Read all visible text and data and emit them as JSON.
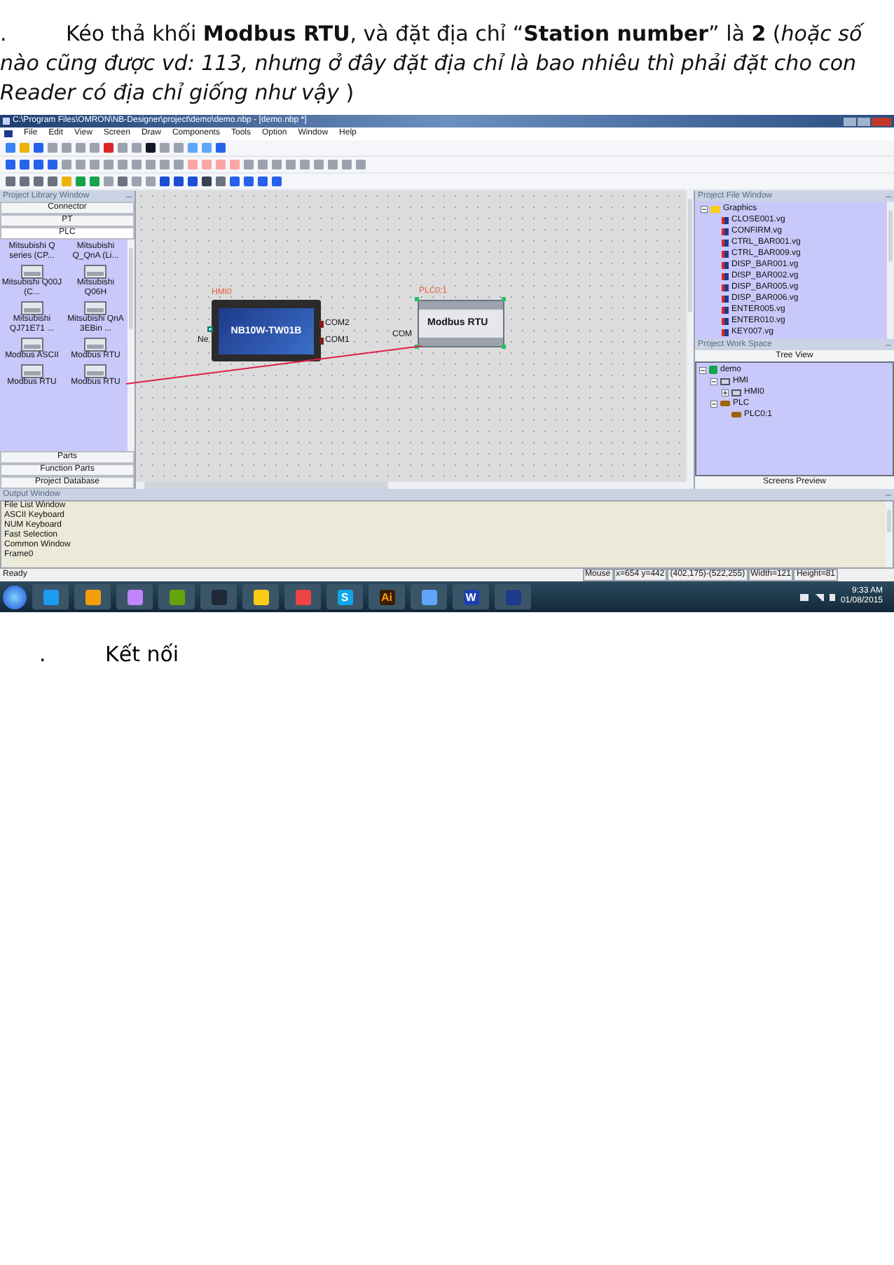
{
  "intro": {
    "bullet": ".",
    "text": "Kéo thả khối **Modbus RTU**, và đặt địa chỉ “**Station number**” là **2** (*hoặc số nào cũng được vd: 113, nhưng ở đây đặt địa chỉ là bao nhiêu thì phải đặt cho con Reader có địa chỉ giống như vậy* )"
  },
  "window": {
    "title": "C:\\Program Files\\OMRON\\NB-Designer\\project\\demo\\demo.nbp - [demo.nbp *]"
  },
  "menu": [
    "File",
    "Edit",
    "View",
    "Screen",
    "Draw",
    "Components",
    "Tools",
    "Option",
    "Window",
    "Help"
  ],
  "library": {
    "title": "Project Library Window",
    "categories_top": [
      {
        "label": "Connector",
        "selected": false
      },
      {
        "label": "PT",
        "selected": false
      },
      {
        "label": "PLC",
        "selected": true
      }
    ],
    "items": [
      {
        "label": "Mitsubishi Q series (CP...",
        "kind": "label"
      },
      {
        "label": "Mitsubishi Q_QnA (Li...",
        "kind": "label"
      },
      {
        "label": "Mitsubishi Q00J (C...",
        "kind": "icon"
      },
      {
        "label": "Mitsubishi Q06H",
        "kind": "icon"
      },
      {
        "label": "Mitsubishi QJ71E71 ...",
        "kind": "icon"
      },
      {
        "label": "Mitsubishi QnA 3EBin ...",
        "kind": "icon"
      },
      {
        "label": "Modbus ASCII",
        "kind": "icon"
      },
      {
        "label": "Modbus RTU",
        "kind": "icon"
      },
      {
        "label": "Modbus RTU",
        "kind": "icon"
      },
      {
        "label": "Modbus RTU",
        "kind": "icon"
      }
    ],
    "categories_bottom": [
      "Parts",
      "Function Parts",
      "Project Database"
    ]
  },
  "canvas": {
    "hmi": {
      "label": "HMI0",
      "model": "NB10W-TW01B",
      "ports": [
        "COM2",
        "COM1"
      ],
      "net": "Ne"
    },
    "plc": {
      "label": "PLC0:1",
      "name": "Modbus RTU",
      "port": "COM"
    }
  },
  "file_window": {
    "title": "Project File Window",
    "tree": [
      {
        "label": "Graphics",
        "kind": "folder",
        "expanded": true,
        "children": [
          {
            "label": "CLOSE001.vg",
            "kind": "file"
          },
          {
            "label": "CONFIRM.vg",
            "kind": "file"
          },
          {
            "label": "CTRL_BAR001.vg",
            "kind": "file"
          },
          {
            "label": "CTRL_BAR009.vg",
            "kind": "file"
          },
          {
            "label": "DISP_BAR001.vg",
            "kind": "file"
          },
          {
            "label": "DISP_BAR002.vg",
            "kind": "file"
          },
          {
            "label": "DISP_BAR005.vg",
            "kind": "file"
          },
          {
            "label": "DISP_BAR006.vg",
            "kind": "file"
          },
          {
            "label": "ENTER005.vg",
            "kind": "file"
          },
          {
            "label": "ENTER010.vg",
            "kind": "file"
          },
          {
            "label": "KEY007.vg",
            "kind": "file"
          }
        ]
      }
    ]
  },
  "work_space": {
    "title": "Project Work Space",
    "tab": "Tree View",
    "tree": [
      {
        "label": "demo",
        "kind": "project",
        "expanded": true,
        "children": [
          {
            "label": "HMI",
            "kind": "screen",
            "expanded": true,
            "children": [
              {
                "label": "HMI0",
                "kind": "screen",
                "expanded": false
              }
            ]
          },
          {
            "label": "PLC",
            "kind": "plc",
            "expanded": true,
            "children": [
              {
                "label": "PLC0:1",
                "kind": "plc"
              }
            ]
          }
        ]
      }
    ],
    "bottom_tab": "Screens Preview"
  },
  "output": {
    "title": "Output Window",
    "lines": [
      "File List Window",
      "ASCII Keyboard",
      "NUM Keyboard",
      "Fast Selection",
      "Common Window",
      "Frame0"
    ]
  },
  "status_bar": {
    "status": "Ready",
    "fields": [
      "Mouse",
      "x=654  y=442",
      "(402,175)-(522,255)",
      "Width=121",
      "Height=81"
    ]
  },
  "taskbar": {
    "apps": [
      {
        "kind": "ie"
      },
      {
        "kind": "media"
      },
      {
        "kind": "chat"
      },
      {
        "kind": "bird"
      },
      {
        "kind": "dark"
      },
      {
        "kind": "folder"
      },
      {
        "kind": "chrome"
      },
      {
        "kind": "skype",
        "glyph": "S"
      },
      {
        "kind": "ai",
        "glyph": "Ai"
      },
      {
        "kind": "monitor"
      },
      {
        "kind": "word",
        "glyph": "W"
      },
      {
        "kind": "nb"
      }
    ],
    "time": "9:33 AM",
    "date": "01/08/2015"
  },
  "next": {
    "bullet": ".",
    "text": "Kết nối"
  }
}
